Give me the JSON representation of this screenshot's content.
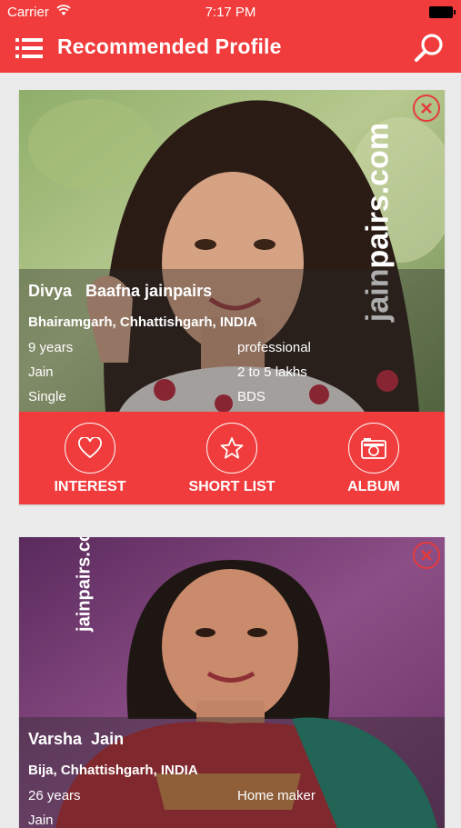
{
  "status_bar": {
    "carrier": "Carrier",
    "time": "7:17 PM"
  },
  "header": {
    "title": "Recommended Profile"
  },
  "watermark": "jainpairs.com",
  "profiles": [
    {
      "name": "Divya   Baafna jainpairs",
      "location": "Bhairamgarh, Chhattishgarh, INDIA",
      "age": "9 years",
      "religion": "Jain",
      "marital_status": "Single",
      "occupation": "professional",
      "income": "2 to 5 lakhs",
      "education": "BDS"
    },
    {
      "name": "Varsha  Jain",
      "location": "Bija, Chhattishgarh, INDIA",
      "age": "26 years",
      "religion": "Jain",
      "occupation": "Home maker"
    }
  ],
  "actions": {
    "interest": "INTEREST",
    "short_list": "SHORT LIST",
    "album": "ALBUM"
  },
  "colors": {
    "brand": "#f03c3c",
    "background": "#ebebeb"
  }
}
